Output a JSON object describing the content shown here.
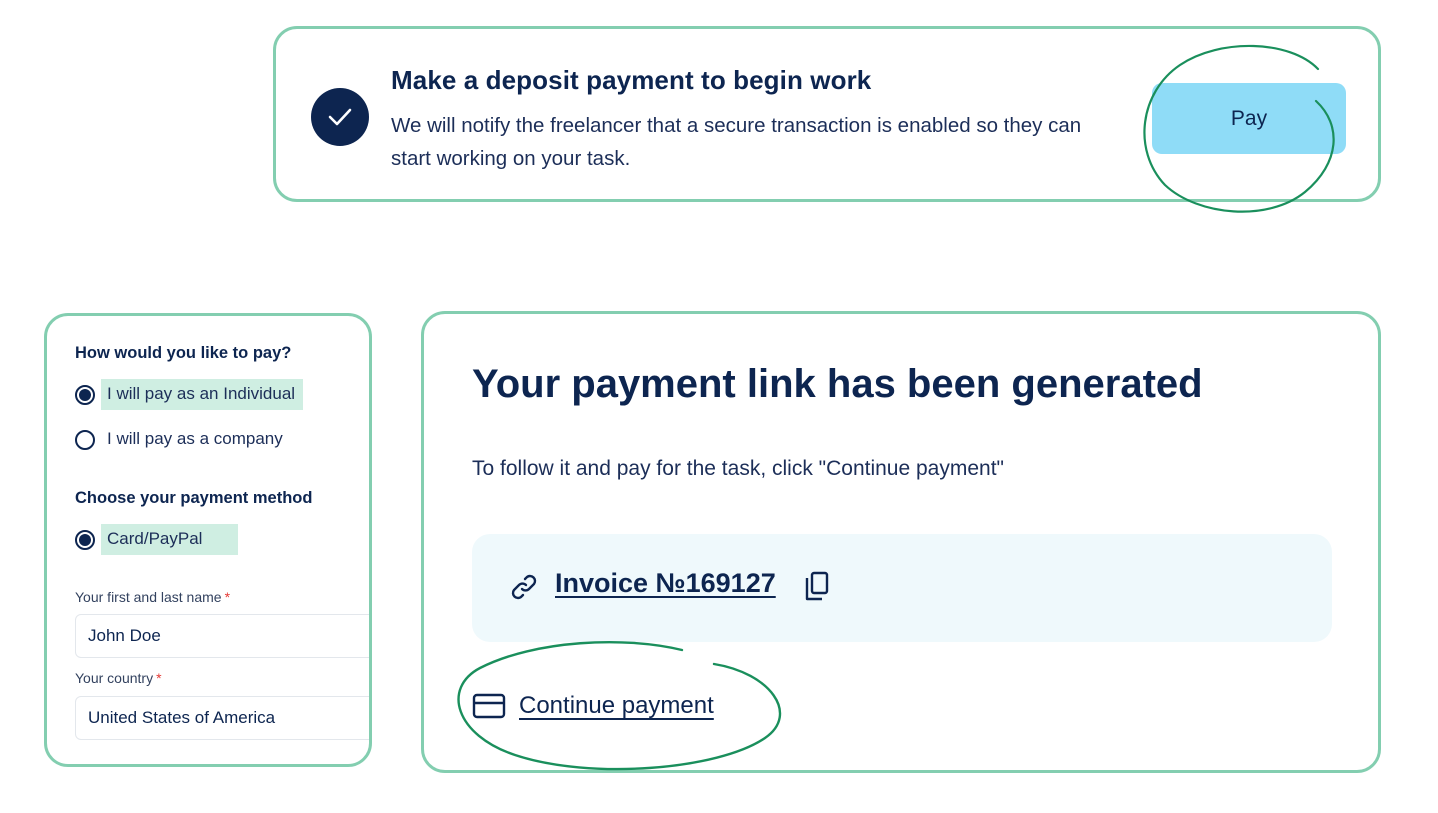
{
  "deposit": {
    "title": "Make a deposit payment  to begin work",
    "description": "We will notify the freelancer that a secure transaction is enabled so they can start working on your task.",
    "pay_label": "Pay",
    "check_icon": "check-icon"
  },
  "payment_form": {
    "payer_question": "How would you like to pay?",
    "payer_options": [
      {
        "label": "I will pay as an Individual",
        "selected": true
      },
      {
        "label": "I will pay as a company",
        "selected": false
      }
    ],
    "method_question": "Choose your payment method",
    "method_options": [
      {
        "label": "Card/PayPal",
        "selected": true
      }
    ],
    "name_label": "Your first and last name",
    "name_value": "John Doe",
    "country_label": "Your country",
    "country_value": "United States of America",
    "required_mark": "*"
  },
  "payment_link": {
    "title": "Your payment link has been generated",
    "description": "To follow it and pay for the task, click \"Continue payment\"",
    "invoice_label": "Invoice №169127",
    "continue_label": "Continue payment",
    "link_icon": "link-icon",
    "copy_icon": "copy-icon",
    "card_icon": "credit-card-icon"
  },
  "colors": {
    "panel_border": "#83ceb0",
    "navy": "#0d2550",
    "pay_button": "#8fdcf7",
    "selection_highlight": "#cfeee2",
    "invoice_box": "#eff9fc",
    "annotation": "#1a8f5c",
    "required": "#e53935"
  }
}
